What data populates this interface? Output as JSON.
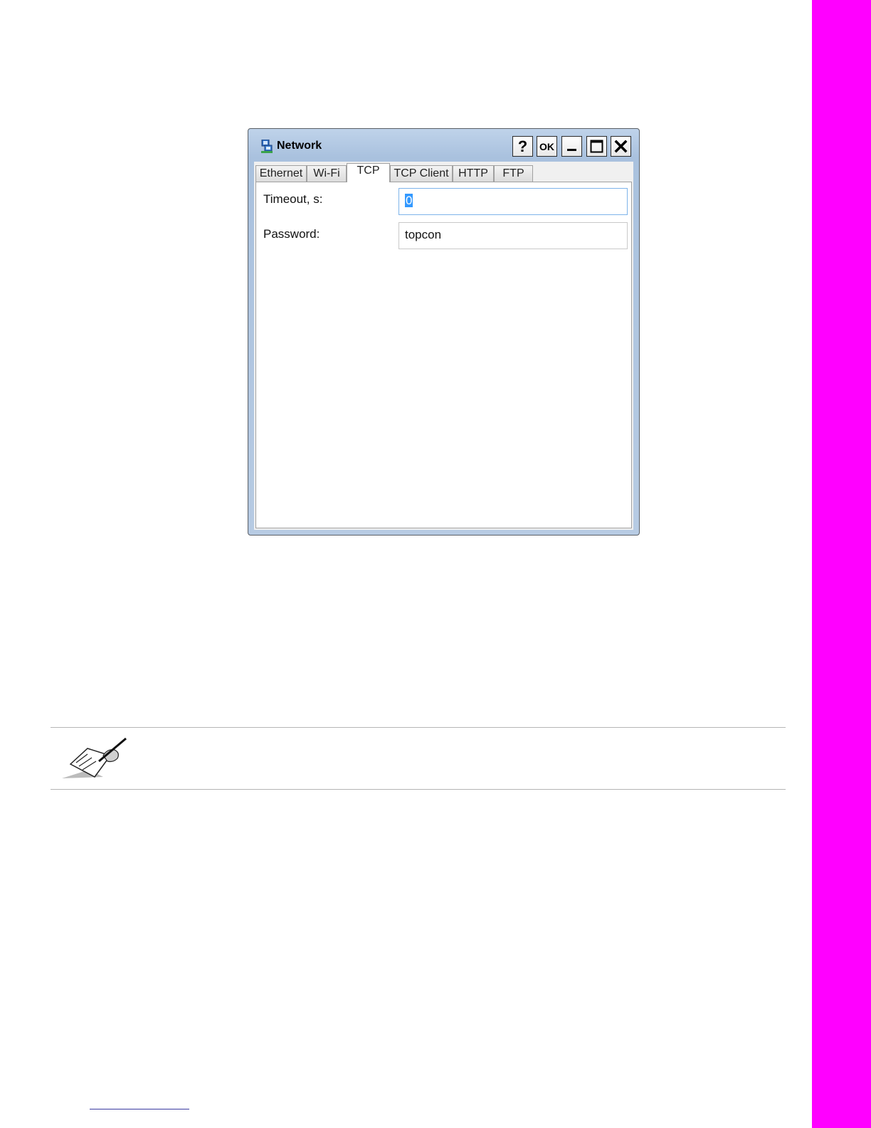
{
  "window": {
    "title": "Network",
    "buttons": {
      "help": "?",
      "ok": "OK"
    }
  },
  "tabs": [
    {
      "label": "Ethernet"
    },
    {
      "label": "Wi-Fi"
    },
    {
      "label": "TCP"
    },
    {
      "label": "TCP Client"
    },
    {
      "label": "HTTP"
    },
    {
      "label": "FTP"
    }
  ],
  "active_tab": "TCP",
  "fields": {
    "timeout": {
      "label": "Timeout, s:",
      "value": "0"
    },
    "password": {
      "label": "Password:",
      "value": "topcon"
    }
  },
  "colors": {
    "side_bar": "#ff00ff",
    "selection": "#3399ff"
  },
  "icons": [
    "network-icon",
    "help-icon",
    "minimize-icon",
    "maximize-icon",
    "close-icon",
    "note-icon"
  ]
}
